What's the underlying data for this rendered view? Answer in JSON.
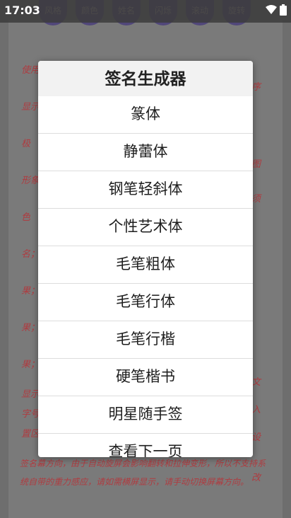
{
  "status": {
    "time": "17:03"
  },
  "top_buttons": [
    "风格",
    "颜色",
    "姓名",
    "闪烁",
    "滚动",
    "旋转"
  ],
  "background_text": {
    "left": [
      "使用",
      "显示",
      "极",
      "形象",
      "色",
      "名；",
      "果；",
      "果；",
      "果；",
      "显示",
      "字号",
      "置区"
    ],
    "right": [
      "序",
      "图",
      "须",
      "文",
      "入",
      "设",
      "改"
    ],
    "bottom": "签名幕方向，由于自动旋屏会影响翻转和拉伸变形，所以不支持系统自带的重力感应，请如需横屏显示，请手动切换屏幕方向。"
  },
  "dialog": {
    "title": "签名生成器",
    "items": [
      "篆体",
      "静蕾体",
      "钢笔轻斜体",
      "个性艺术体",
      "毛笔粗体",
      "毛笔行体",
      "毛笔行楷",
      "硬笔楷书",
      "明星随手签",
      "查看下一页"
    ]
  }
}
